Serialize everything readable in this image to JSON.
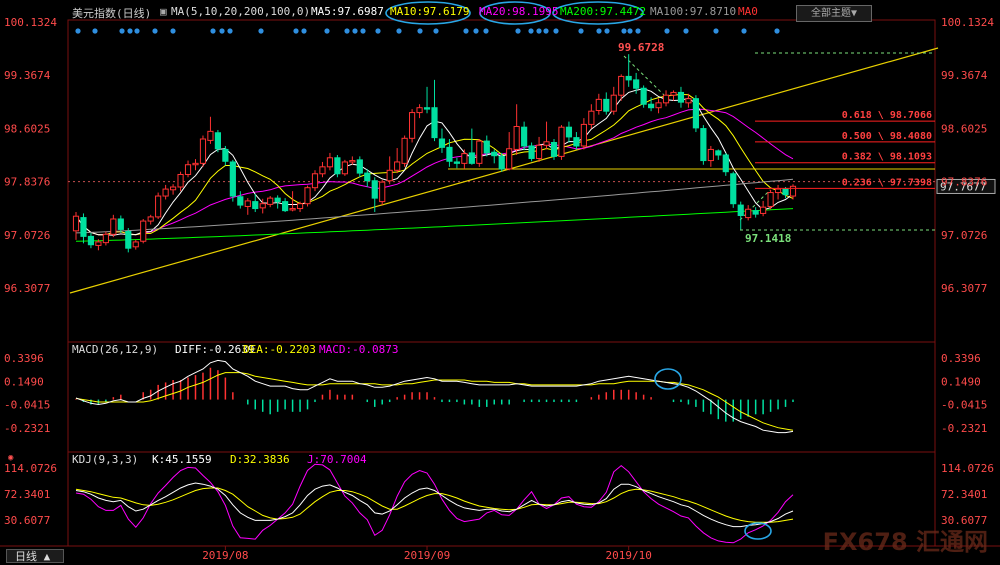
{
  "header": {
    "title": "美元指数(日线)",
    "ma_label": "MA(5,10,20,200,100,0)",
    "ma5": "MA5:97.6987",
    "ma10": "MA10:97.6179",
    "ma20": "MA20:98.1995",
    "ma200": "MA200:97.4472",
    "ma100": "MA100:97.8710",
    "ma0": "MA0",
    "topic_button": "全部主题▼"
  },
  "macd_header": {
    "params": "MACD(26,12,9)",
    "diff": "DIFF:-0.2639",
    "dea": "DEA:-0.2203",
    "macd": "MACD:-0.0873"
  },
  "kdj_header": {
    "params": "KDJ(9,3,3)",
    "k": "K:45.1559",
    "d": "D:32.3836",
    "j": "J:70.7004"
  },
  "timeframe_button": "日线 ▲",
  "watermark": "FX678 汇通网",
  "colors": {
    "up": "#ff3232",
    "down": "#00e0a0",
    "ma5": "#ffffff",
    "ma10": "#ffff00",
    "ma20": "#ff00ff",
    "ma200": "#00ff00",
    "ma100": "#999999",
    "axis": "#ff4b4b",
    "fib": "#ff2020",
    "highlight": "#29a7e6"
  },
  "chart_data": [
    {
      "type": "candlestick",
      "title": "美元指数(日线)",
      "y_ticks": [
        "100.1324",
        "99.3674",
        "98.6025",
        "97.8376",
        "97.0726",
        "96.3077"
      ],
      "y_range": [
        96.1,
        100.15
      ],
      "x_ticks": [
        "2019/08",
        "2019/09",
        "2019/10"
      ],
      "current_price": "97.7677",
      "high_label": "99.6728",
      "low_label": "97.1418",
      "fib_levels": [
        {
          "label": "0.618 \\ 98.7066",
          "value": 98.7066
        },
        {
          "label": "0.500 \\ 98.4080",
          "value": 98.408
        },
        {
          "label": "0.382 \\ 98.1093",
          "value": 98.1093
        },
        {
          "label": "0.236 \\ 97.7398",
          "value": 97.7398
        }
      ],
      "candles": [
        [
          97.13,
          97.34,
          97.0,
          97.4
        ],
        [
          97.32,
          97.05,
          96.95,
          97.38
        ],
        [
          97.05,
          96.93,
          96.88,
          97.1
        ],
        [
          96.92,
          96.97,
          96.85,
          97.01
        ],
        [
          96.96,
          97.08,
          96.92,
          97.12
        ],
        [
          97.08,
          97.3,
          97.04,
          97.36
        ],
        [
          97.3,
          97.15,
          97.1,
          97.35
        ],
        [
          97.12,
          96.88,
          96.82,
          97.17
        ],
        [
          96.9,
          96.97,
          96.86,
          97.0
        ],
        [
          96.98,
          97.27,
          96.95,
          97.3
        ],
        [
          97.27,
          97.33,
          97.22,
          97.36
        ],
        [
          97.33,
          97.63,
          97.3,
          97.68
        ],
        [
          97.63,
          97.73,
          97.58,
          97.79
        ],
        [
          97.72,
          97.76,
          97.65,
          97.8
        ],
        [
          97.76,
          97.94,
          97.7,
          97.98
        ],
        [
          97.94,
          98.08,
          97.9,
          98.14
        ],
        [
          98.08,
          98.1,
          98.0,
          98.16
        ],
        [
          98.1,
          98.45,
          98.05,
          98.5
        ],
        [
          98.43,
          98.56,
          98.38,
          98.77
        ],
        [
          98.54,
          98.31,
          98.26,
          98.58
        ],
        [
          98.3,
          98.13,
          98.07,
          98.35
        ],
        [
          98.12,
          97.63,
          97.55,
          98.15
        ],
        [
          97.62,
          97.5,
          97.45,
          97.7
        ],
        [
          97.48,
          97.56,
          97.36,
          97.6
        ],
        [
          97.55,
          97.45,
          97.4,
          97.66
        ],
        [
          97.46,
          97.52,
          97.38,
          97.59
        ],
        [
          97.51,
          97.6,
          97.47,
          97.63
        ],
        [
          97.6,
          97.55,
          97.45,
          97.64
        ],
        [
          97.55,
          97.42,
          97.4,
          97.6
        ],
        [
          97.43,
          97.45,
          97.41,
          97.7
        ],
        [
          97.45,
          97.52,
          97.4,
          97.55
        ],
        [
          97.52,
          97.75,
          97.48,
          97.78
        ],
        [
          97.75,
          97.95,
          97.7,
          98.0
        ],
        [
          97.95,
          98.05,
          97.9,
          98.12
        ],
        [
          98.05,
          98.18,
          98.0,
          98.25
        ],
        [
          98.18,
          97.95,
          97.9,
          98.22
        ],
        [
          97.95,
          98.12,
          97.92,
          98.15
        ],
        [
          98.12,
          98.14,
          98.08,
          98.2
        ],
        [
          98.15,
          97.96,
          97.9,
          98.2
        ],
        [
          97.96,
          97.85,
          97.76,
          98.02
        ],
        [
          97.85,
          97.6,
          97.4,
          97.9
        ],
        [
          97.55,
          97.83,
          97.5,
          97.86
        ],
        [
          97.85,
          98.0,
          97.8,
          98.2
        ],
        [
          98.0,
          98.12,
          97.96,
          98.32
        ],
        [
          98.1,
          98.46,
          98.05,
          98.5
        ],
        [
          98.46,
          98.83,
          98.4,
          98.88
        ],
        [
          98.83,
          98.9,
          98.75,
          98.95
        ],
        [
          98.9,
          98.88,
          98.82,
          99.2
        ],
        [
          98.9,
          98.47,
          98.42,
          99.3
        ],
        [
          98.45,
          98.33,
          98.25,
          98.6
        ],
        [
          98.33,
          98.13,
          98.05,
          98.45
        ],
        [
          98.12,
          98.1,
          98.03,
          98.18
        ],
        [
          98.1,
          98.24,
          98.02,
          98.3
        ],
        [
          98.25,
          98.1,
          98.08,
          98.6
        ],
        [
          98.1,
          98.42,
          98.05,
          98.45
        ],
        [
          98.42,
          98.25,
          98.2,
          98.5
        ],
        [
          98.26,
          98.21,
          98.1,
          98.3
        ],
        [
          98.2,
          98.02,
          97.98,
          98.25
        ],
        [
          98.02,
          98.31,
          98.0,
          98.55
        ],
        [
          98.3,
          98.63,
          98.22,
          98.95
        ],
        [
          98.62,
          98.35,
          98.29,
          98.7
        ],
        [
          98.35,
          98.17,
          98.13,
          98.4
        ],
        [
          98.17,
          98.36,
          98.12,
          98.48
        ],
        [
          98.36,
          98.41,
          98.3,
          98.7
        ],
        [
          98.4,
          98.2,
          98.15,
          98.45
        ],
        [
          98.2,
          98.62,
          98.15,
          98.65
        ],
        [
          98.62,
          98.48,
          98.4,
          98.7
        ],
        [
          98.47,
          98.35,
          98.3,
          98.55
        ],
        [
          98.35,
          98.66,
          98.3,
          98.75
        ],
        [
          98.66,
          98.85,
          98.6,
          98.95
        ],
        [
          98.86,
          99.02,
          98.8,
          99.1
        ],
        [
          99.02,
          98.85,
          98.8,
          99.12
        ],
        [
          98.85,
          99.08,
          98.8,
          99.2
        ],
        [
          99.08,
          99.35,
          99.0,
          99.38
        ],
        [
          99.35,
          99.3,
          99.2,
          99.67
        ],
        [
          99.3,
          99.18,
          99.1,
          99.4
        ],
        [
          99.18,
          98.95,
          98.9,
          99.22
        ],
        [
          98.95,
          98.9,
          98.85,
          99.05
        ],
        [
          98.9,
          98.97,
          98.82,
          99.03
        ],
        [
          98.97,
          99.08,
          98.92,
          99.15
        ],
        [
          99.08,
          99.12,
          99.0,
          99.15
        ],
        [
          99.12,
          98.98,
          98.9,
          99.2
        ],
        [
          98.97,
          99.03,
          98.9,
          99.1
        ],
        [
          99.03,
          98.61,
          98.55,
          99.08
        ],
        [
          98.6,
          98.14,
          98.08,
          98.65
        ],
        [
          98.14,
          98.3,
          98.05,
          98.35
        ],
        [
          98.28,
          98.22,
          98.15,
          98.3
        ],
        [
          98.22,
          97.98,
          97.92,
          98.25
        ],
        [
          97.95,
          97.52,
          97.46,
          97.98
        ],
        [
          97.5,
          97.35,
          97.15,
          97.55
        ],
        [
          97.32,
          97.44,
          97.28,
          97.5
        ],
        [
          97.42,
          97.37,
          97.32,
          97.47
        ],
        [
          97.38,
          97.47,
          97.34,
          97.56
        ],
        [
          97.48,
          97.68,
          97.44,
          97.72
        ],
        [
          97.68,
          97.73,
          97.58,
          97.79
        ],
        [
          97.73,
          97.65,
          97.6,
          97.76
        ],
        [
          97.63,
          97.77,
          97.58,
          97.8
        ]
      ]
    },
    {
      "type": "bar",
      "title": "MACD(26,12,9)",
      "y_ticks": [
        "0.3396",
        "0.1490",
        "-0.0415",
        "-0.2321"
      ],
      "y_range": [
        -0.4,
        0.45
      ],
      "series": [
        {
          "name": "DIFF",
          "values": [
            0.013,
            -0.01,
            -0.03,
            -0.04,
            -0.03,
            -0.01,
            0.0,
            -0.02,
            -0.02,
            0.01,
            0.03,
            0.07,
            0.1,
            0.13,
            0.15,
            0.19,
            0.22,
            0.25,
            0.3,
            0.32,
            0.31,
            0.25,
            0.22,
            0.19,
            0.15,
            0.13,
            0.11,
            0.11,
            0.11,
            0.09,
            0.08,
            0.08,
            0.11,
            0.14,
            0.17,
            0.15,
            0.15,
            0.15,
            0.13,
            0.12,
            0.1,
            0.1,
            0.11,
            0.13,
            0.15,
            0.16,
            0.17,
            0.18,
            0.17,
            0.15,
            0.15,
            0.15,
            0.14,
            0.13,
            0.12,
            0.12,
            0.12,
            0.12,
            0.12,
            0.13,
            0.12,
            0.11,
            0.11,
            0.11,
            0.11,
            0.11,
            0.11,
            0.11,
            0.12,
            0.13,
            0.15,
            0.16,
            0.17,
            0.18,
            0.19,
            0.18,
            0.17,
            0.16,
            0.15,
            0.14,
            0.13,
            0.12,
            0.1,
            0.07,
            0.03,
            -0.01,
            -0.06,
            -0.11,
            -0.15,
            -0.18,
            -0.2,
            -0.22,
            -0.25,
            -0.26,
            -0.27,
            -0.27,
            -0.26
          ]
        },
        {
          "name": "DEA",
          "values": [
            0.01,
            0.0,
            -0.01,
            -0.02,
            -0.02,
            -0.02,
            -0.02,
            -0.02,
            -0.02,
            -0.02,
            -0.01,
            0.01,
            0.03,
            0.05,
            0.07,
            0.1,
            0.12,
            0.14,
            0.17,
            0.2,
            0.22,
            0.22,
            0.22,
            0.21,
            0.19,
            0.18,
            0.17,
            0.16,
            0.15,
            0.14,
            0.13,
            0.12,
            0.12,
            0.12,
            0.13,
            0.13,
            0.13,
            0.13,
            0.13,
            0.13,
            0.13,
            0.12,
            0.12,
            0.12,
            0.13,
            0.13,
            0.14,
            0.15,
            0.16,
            0.16,
            0.16,
            0.16,
            0.16,
            0.15,
            0.15,
            0.15,
            0.14,
            0.14,
            0.14,
            0.13,
            0.13,
            0.12,
            0.12,
            0.12,
            0.12,
            0.12,
            0.12,
            0.12,
            0.12,
            0.12,
            0.13,
            0.13,
            0.13,
            0.14,
            0.15,
            0.15,
            0.15,
            0.15,
            0.15,
            0.14,
            0.14,
            0.13,
            0.12,
            0.1,
            0.08,
            0.05,
            0.02,
            -0.02,
            -0.06,
            -0.1,
            -0.13,
            -0.16,
            -0.19,
            -0.21,
            -0.23,
            -0.24,
            -0.25
          ]
        }
      ]
    },
    {
      "type": "line",
      "title": "KDJ(9,3,3)",
      "y_ticks": [
        "114.0726",
        "72.3401",
        "30.6077"
      ],
      "y_range": [
        -5,
        120
      ],
      "series": [
        {
          "name": "K",
          "values": [
            78,
            76,
            72,
            66,
            62,
            60,
            62,
            52,
            45,
            48,
            55,
            62,
            68,
            75,
            82,
            87,
            90,
            88,
            85,
            80,
            70,
            55,
            42,
            35,
            30,
            30,
            30,
            32,
            36,
            42,
            55,
            70,
            80,
            85,
            87,
            82,
            75,
            70,
            62,
            55,
            42,
            40,
            45,
            55,
            66,
            74,
            80,
            82,
            78,
            70,
            62,
            55,
            50,
            48,
            46,
            48,
            48,
            45,
            44,
            48,
            55,
            62,
            56,
            53,
            55,
            60,
            62,
            58,
            56,
            55,
            58,
            65,
            80,
            88,
            88,
            84,
            78,
            73,
            68,
            64,
            60,
            55,
            52,
            45,
            38,
            32,
            27,
            23,
            20,
            20,
            22,
            23,
            25,
            28,
            33,
            40,
            45
          ]
        },
        {
          "name": "D",
          "values": [
            80,
            78,
            76,
            73,
            70,
            67,
            66,
            62,
            58,
            55,
            54,
            56,
            59,
            63,
            68,
            73,
            78,
            81,
            82,
            82,
            78,
            72,
            62,
            52,
            45,
            38,
            34,
            32,
            33,
            35,
            40,
            50,
            60,
            68,
            75,
            78,
            78,
            76,
            72,
            67,
            60,
            53,
            48,
            48,
            53,
            59,
            65,
            70,
            73,
            73,
            70,
            66,
            61,
            57,
            53,
            51,
            49,
            48,
            47,
            48,
            51,
            55,
            56,
            55,
            55,
            57,
            59,
            59,
            58,
            57,
            57,
            60,
            66,
            73,
            78,
            80,
            79,
            77,
            74,
            71,
            68,
            64,
            61,
            57,
            52,
            47,
            42,
            37,
            33,
            30,
            28,
            27,
            27,
            27,
            28,
            30,
            32
          ]
        },
        {
          "name": "J",
          "values": [
            74,
            72,
            64,
            52,
            46,
            46,
            54,
            32,
            19,
            34,
            57,
            74,
            86,
            99,
            110,
            115,
            114,
            102,
            91,
            76,
            54,
            21,
            2,
            1,
            0,
            14,
            22,
            32,
            42,
            56,
            85,
            110,
            120,
            119,
            111,
            90,
            69,
            58,
            42,
            31,
            6,
            14,
            39,
            69,
            92,
            104,
            110,
            106,
            88,
            64,
            46,
            33,
            28,
            30,
            32,
            42,
            46,
            39,
            38,
            48,
            63,
            76,
            56,
            49,
            55,
            66,
            68,
            56,
            52,
            51,
            60,
            75,
            108,
            118,
            108,
            92,
            76,
            65,
            56,
            50,
            44,
            37,
            34,
            21,
            10,
            2,
            -3,
            -5,
            -6,
            0,
            10,
            15,
            21,
            30,
            43,
            60,
            71
          ]
        }
      ]
    }
  ]
}
